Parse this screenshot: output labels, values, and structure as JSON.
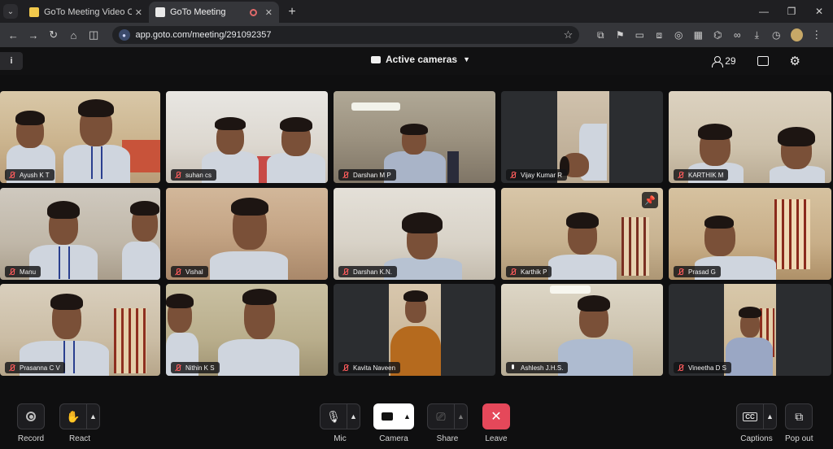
{
  "browser": {
    "tabs": [
      {
        "title": "GoTo Meeting Video Conferenc",
        "active": false
      },
      {
        "title": "GoTo Meeting",
        "active": true
      }
    ],
    "url": "app.goto.com/meeting/291092357"
  },
  "meeting": {
    "view_label": "Active cameras",
    "participant_count": "29"
  },
  "participants": [
    {
      "name": "Ayush K T",
      "muted": true
    },
    {
      "name": "suhan cs",
      "muted": true
    },
    {
      "name": "Darshan M P",
      "muted": true
    },
    {
      "name": "Vijay Kumar R",
      "muted": true
    },
    {
      "name": "KARTHIK M",
      "muted": true
    },
    {
      "name": "Manu",
      "muted": true
    },
    {
      "name": "Vishal",
      "muted": true
    },
    {
      "name": "Darshan K.N.",
      "muted": true
    },
    {
      "name": "Karthik P",
      "muted": true,
      "pinned": true
    },
    {
      "name": "Prasad G",
      "muted": true
    },
    {
      "name": "Prasanna C V",
      "muted": true
    },
    {
      "name": "Nithin K S",
      "muted": true
    },
    {
      "name": "Kavita Naveen",
      "muted": true
    },
    {
      "name": "Ashlesh J.H.S.",
      "muted": false
    },
    {
      "name": "Vineetha D S",
      "muted": true
    }
  ],
  "controls": {
    "record": "Record",
    "react": "React",
    "mic": "Mic",
    "camera": "Camera",
    "share": "Share",
    "leave": "Leave",
    "captions": "Captions",
    "popout": "Pop out"
  },
  "colors": {
    "leave": "#e5485a",
    "muted_indicator": "#ff5c5c",
    "background": "#0f0f10"
  },
  "icons": [
    "info-icon",
    "camera-icon",
    "people-icon",
    "chat-icon",
    "gear-icon",
    "record-icon",
    "hand-icon",
    "mic-off-icon",
    "video-icon",
    "screen-share-off-icon",
    "close-icon",
    "captions-icon",
    "popout-icon",
    "pin-icon"
  ]
}
